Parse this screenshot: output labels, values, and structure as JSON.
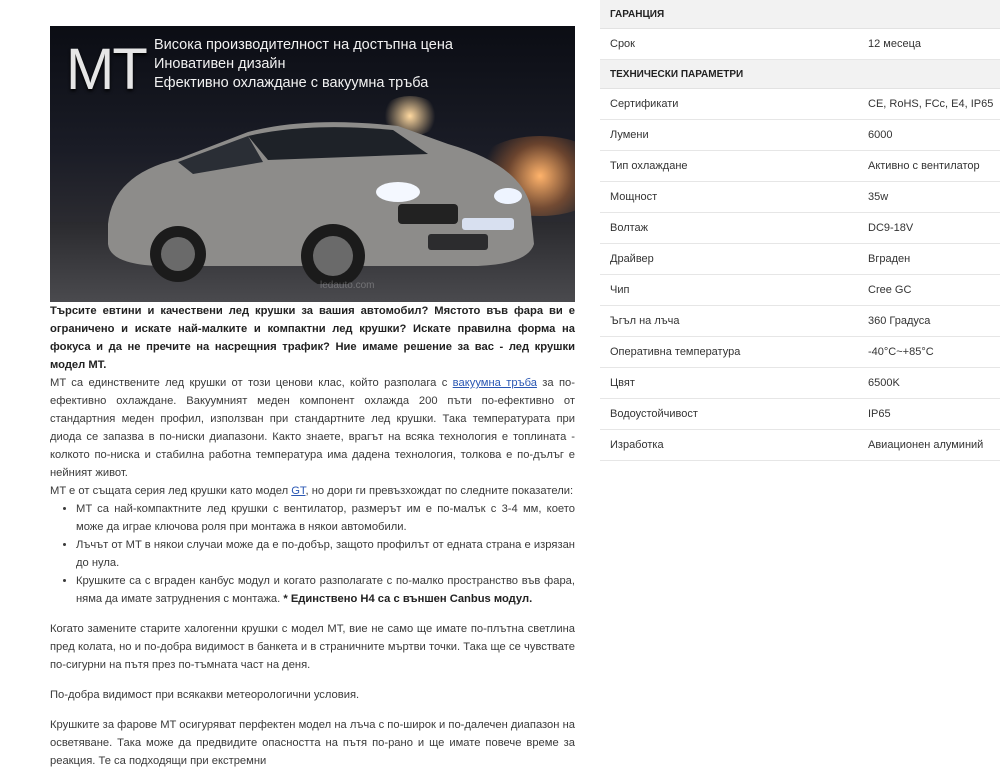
{
  "hero": {
    "logo": "MT",
    "tags": [
      "Висока производителност на достъпна цена",
      "Иновативен дизайн",
      "Ефективно охлаждане с вакуумна тръба"
    ],
    "watermark": "ledauto.com"
  },
  "article": {
    "intro": "Търсите евтини и качествени лед крушки за вашия автомобил? Мястото във фара ви е ограничено и искате най-малките и компактни лед крушки?  Искате правилна форма на фокуса и да не пречите на насрещния трафик? Ние имаме решение за вас - лед крушки модел MT.",
    "p1_before": "MT са единствените лед крушки от този ценови клас, който разполага с ",
    "p1_link": "вакуумна тръба",
    "p1_after": " за по-ефективно охлаждане. Вакуумният меден компонент охлажда 200 пъти по-ефективно от стандартния меден профил, използван при стандартните лед крушки. Така температурата при диода се запазва в по-ниски диапазони. Както знаете, врагът на всяка технология е топлината - колкото  по-ниска и стабилна работна температура има дадена технология, толкова е по-дълъг е нейният живот.",
    "p2_before": "MT е от същата серия лед крушки като модел ",
    "p2_link": "GT",
    "p2_after": ", но дори ги превъзхождат по следните показатели:",
    "bullets": [
      "MT са най-компактните лед крушки с вентилатор, размерът им е по-малък с 3-4 мм, което може да играе ключова роля при монтажа в някои автомобили.",
      "Лъчът от MT в някои случаи може да е по-добър, защото  профилът от едната страна е изрязан до нула."
    ],
    "bullet3_text": "Крушките са с вграден канбус модул и когато разполагате с по-малко пространство във фара, няма да имате затруднения с монтажа. ",
    "bullet3_bold": "* Единствено H4 са с външен Canbus модул.",
    "p3": "Когато замените старите халогенни крушки с модел MT, вие не само ще имате по-плътна светлина пред колата,  но и по-добра видимост в банкета и в страничните мъртви точки. Така  ще се чувствате по-сигурни на пътя през по-тъмната част на деня.",
    "p4": "По-добра видимост при всякакви метеорологични условия.",
    "p5": "Крушките за фарове MT осигуряват перфектен модел на лъча с по-широк и по-далечен диапазон на осветяване. Така може да предвидите опасността на пътя по-рано и ще имате повече време за реакция. Те са подходящи при екстремни"
  },
  "specs": {
    "warranty_header": "ГАРАНЦИЯ",
    "warranty": [
      {
        "k": "Срок",
        "v": "12 месеца"
      }
    ],
    "tech_header": "ТЕХНИЧЕСКИ ПАРАМЕТРИ",
    "tech": [
      {
        "k": "Сертификати",
        "v": "CE, RoHS, FCc, E4, IP65"
      },
      {
        "k": "Лумени",
        "v": "6000"
      },
      {
        "k": "Тип охлаждане",
        "v": "Активно с вентилатор"
      },
      {
        "k": "Мощност",
        "v": "35w"
      },
      {
        "k": "Волтаж",
        "v": "DC9-18V"
      },
      {
        "k": "Драйвер",
        "v": "Вграден"
      },
      {
        "k": "Чип",
        "v": "Cree GC"
      },
      {
        "k": "Ъгъл на лъча",
        "v": "360 Градуса"
      },
      {
        "k": "Оперативна температура",
        "v": "-40°C~+85°C"
      },
      {
        "k": "Цвят",
        "v": "6500K"
      },
      {
        "k": "Водоустойчивост",
        "v": "IP65"
      },
      {
        "k": "Изработка",
        "v": "Авиационен алуминий"
      }
    ]
  }
}
